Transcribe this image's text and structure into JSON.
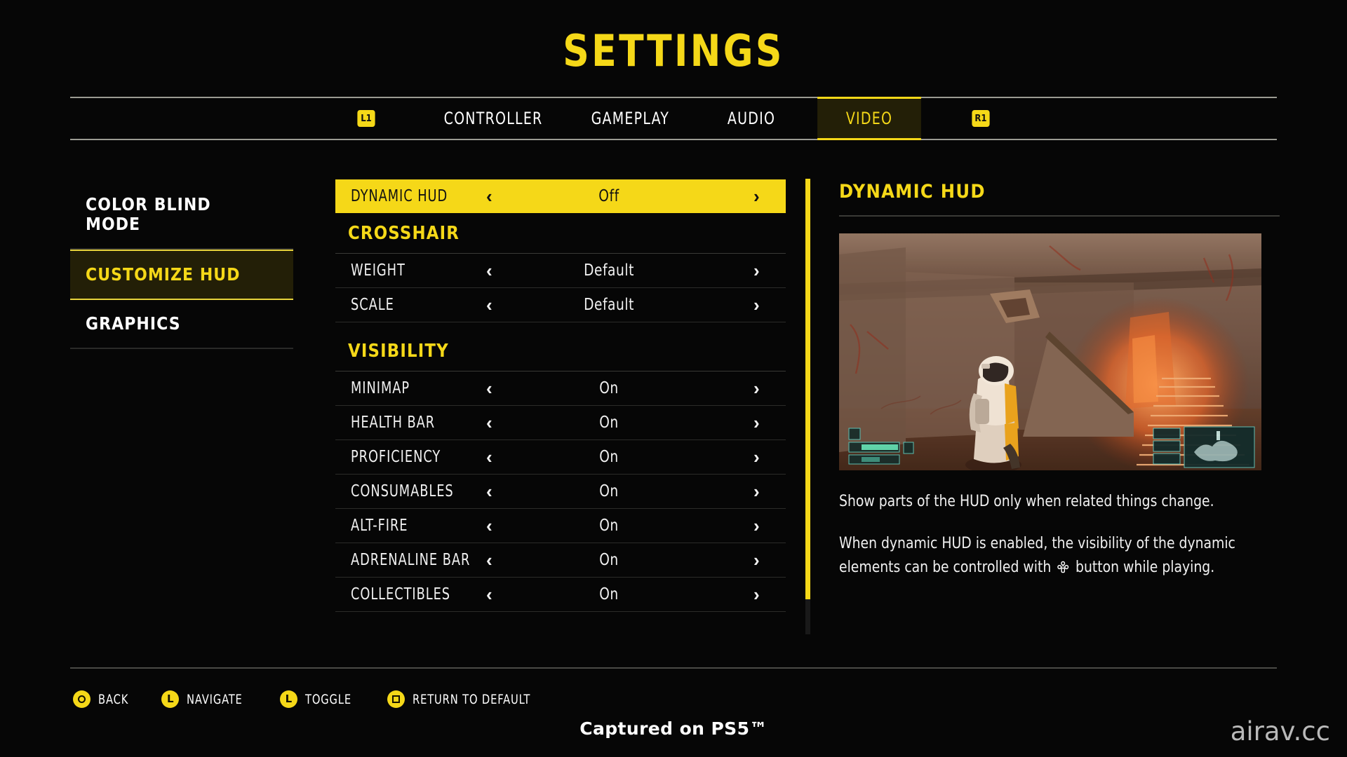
{
  "page_title": "SETTINGS",
  "tabs": {
    "left_bumper": "L1",
    "right_bumper": "R1",
    "items": [
      {
        "label": "CONTROLLER",
        "active": false
      },
      {
        "label": "GAMEPLAY",
        "active": false
      },
      {
        "label": "AUDIO",
        "active": false
      },
      {
        "label": "VIDEO",
        "active": true
      }
    ]
  },
  "sidebar": {
    "items": [
      {
        "label": "COLOR BLIND MODE",
        "active": false
      },
      {
        "label": "CUSTOMIZE HUD",
        "active": true
      },
      {
        "label": "GRAPHICS",
        "active": false
      }
    ]
  },
  "options": {
    "selected_row": {
      "label": "DYNAMIC HUD",
      "value": "Off",
      "prev_arrow": "‹",
      "next_arrow": "›"
    },
    "sections": [
      {
        "heading": "CROSSHAIR",
        "rows": [
          {
            "label": "WEIGHT",
            "value": "Default"
          },
          {
            "label": "SCALE",
            "value": "Default"
          }
        ]
      },
      {
        "heading": "VISIBILITY",
        "rows": [
          {
            "label": "MINIMAP",
            "value": "On"
          },
          {
            "label": "HEALTH BAR",
            "value": "On"
          },
          {
            "label": "PROFICIENCY",
            "value": "On"
          },
          {
            "label": "CONSUMABLES",
            "value": "On"
          },
          {
            "label": "ALT-FIRE",
            "value": "On"
          },
          {
            "label": "ADRENALINE BAR",
            "value": "On"
          },
          {
            "label": "COLLECTIBLES",
            "value": "On"
          }
        ]
      }
    ],
    "prev_arrow": "‹",
    "next_arrow": "›"
  },
  "detail": {
    "heading": "DYNAMIC HUD",
    "paragraph_1": "Show parts of the HUD only when related things change.",
    "paragraph_2_before": "When dynamic HUD is enabled, the visibility of the dynamic elements can be controlled with",
    "paragraph_2_after": "button while playing."
  },
  "footer": {
    "hints": [
      {
        "icon": "circle-button-icon",
        "label": "BACK"
      },
      {
        "icon": "left-stick-icon",
        "label": "NAVIGATE"
      },
      {
        "icon": "left-stick-icon",
        "label": "TOGGLE"
      },
      {
        "icon": "square-button-icon",
        "label": "RETURN TO DEFAULT"
      }
    ],
    "captured_note": "Captured on PS5™",
    "watermark": "airav.cc"
  },
  "colors": {
    "accent": "#f5d818",
    "accent_dim": "#231f07",
    "background": "#060606",
    "text": "#f1f1f1"
  }
}
